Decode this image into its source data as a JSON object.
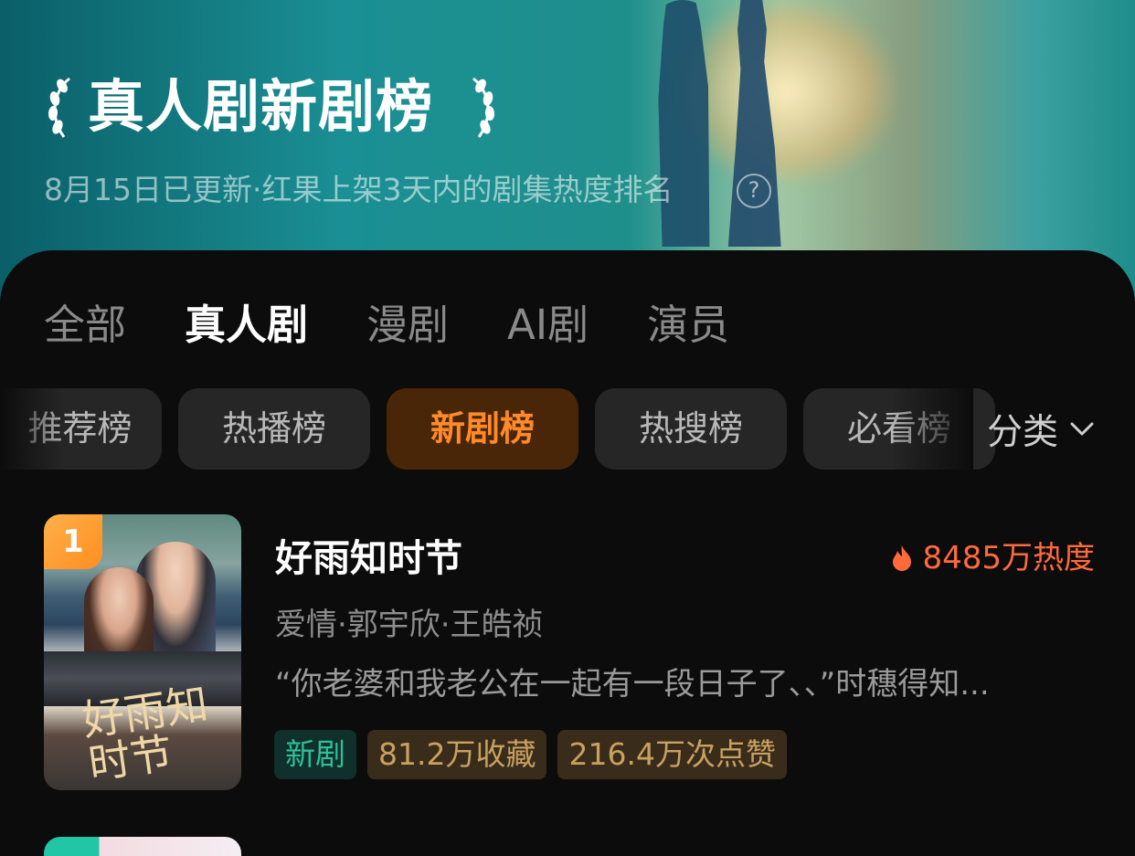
{
  "banner": {
    "title": "真人剧新剧榜",
    "subtitle": "8月15日已更新·红果上架3天内的剧集热度排名",
    "help_icon": "?"
  },
  "main_tabs": [
    {
      "label": "全部",
      "active": false
    },
    {
      "label": "真人剧",
      "active": true
    },
    {
      "label": "漫剧",
      "active": false
    },
    {
      "label": "AI剧",
      "active": false
    },
    {
      "label": "演员",
      "active": false
    }
  ],
  "chips": [
    {
      "label": "推荐榜",
      "active": false
    },
    {
      "label": "热播榜",
      "active": false
    },
    {
      "label": "新剧榜",
      "active": true
    },
    {
      "label": "热搜榜",
      "active": false
    },
    {
      "label": "必看榜",
      "active": false
    }
  ],
  "filter": {
    "label": "分类",
    "icon": "chevron-down-icon"
  },
  "items": [
    {
      "rank": "1",
      "title": "好雨知时节",
      "heat": "8485万热度",
      "meta": "爱情·郭宇欣·王皓祯",
      "description": "“你老婆和我老公在一起有一段日子了、、”时穗得知...",
      "poster_title": "好雨知时节",
      "tags": {
        "new": "新剧",
        "favorites": "81.2万收藏",
        "likes": "216.4万次点赞"
      }
    }
  ],
  "colors": {
    "accent_orange": "#ff8a2a",
    "heat_red": "#ff6a3d",
    "new_green": "#2fbf98",
    "banner_teal": "#1a8f94"
  }
}
